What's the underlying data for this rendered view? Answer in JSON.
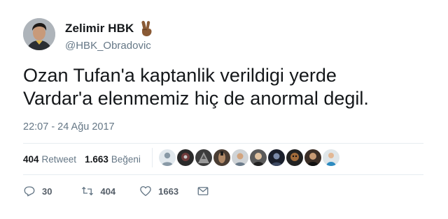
{
  "author": {
    "display_name": "Zelimir HBK",
    "handle": "@HBK_Obradovic",
    "emoji": "victory-hand"
  },
  "tweet": {
    "lines": [
      "Ozan Tufan'a kaptanlik verildigi yerde",
      "Vardar'a elenmemiz hiç de anormal degil."
    ],
    "timestamp": "22:07 - 24 Ağu 2017"
  },
  "stats": {
    "retweets_count": "404",
    "retweets_label": "Retweet",
    "likes_count": "1.663",
    "likes_label": "Beğeni"
  },
  "likers_count_shown": 10,
  "actions": {
    "reply_count": "30",
    "retweet_count": "404",
    "like_count": "1663"
  },
  "colors": {
    "text": "#14171a",
    "muted": "#657786",
    "divider": "#e6ecf0"
  }
}
